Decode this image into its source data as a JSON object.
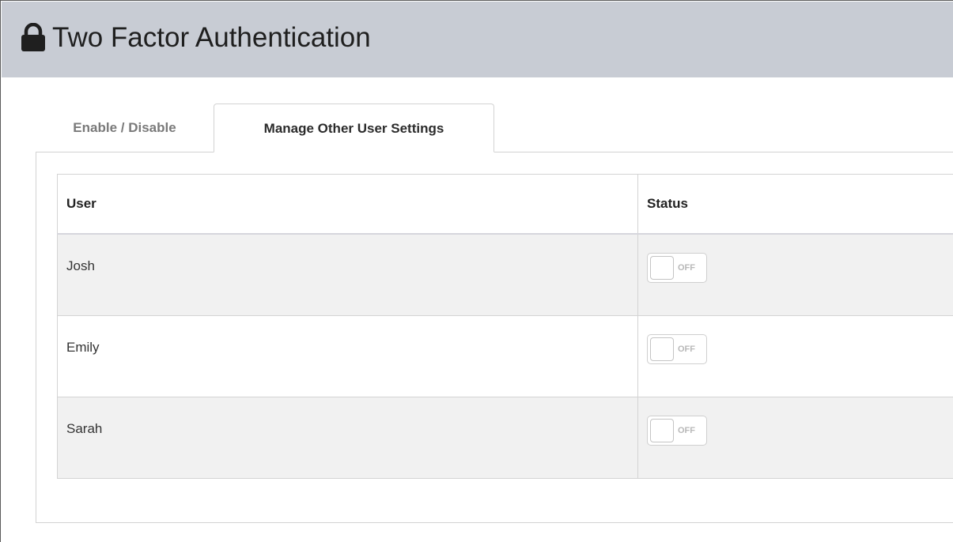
{
  "header": {
    "icon": "lock-icon",
    "title": "Two Factor Authentication"
  },
  "tabs": [
    {
      "label": "Enable / Disable",
      "active": false
    },
    {
      "label": "Manage Other User Settings",
      "active": true
    }
  ],
  "table": {
    "columns": [
      "User",
      "Status"
    ],
    "rows": [
      {
        "user": "Josh",
        "status": "OFF",
        "enabled": false
      },
      {
        "user": "Emily",
        "status": "OFF",
        "enabled": false
      },
      {
        "user": "Sarah",
        "status": "OFF",
        "enabled": false
      }
    ]
  },
  "colors": {
    "header_bg": "#c8ccd4",
    "row_alt_bg": "#f1f1f1",
    "border": "#d3d3d3"
  }
}
